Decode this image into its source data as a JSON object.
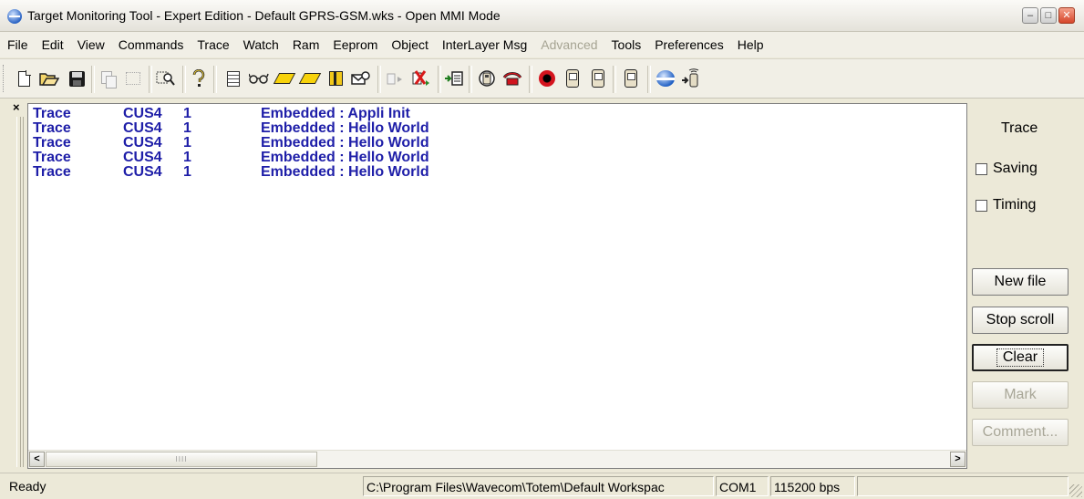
{
  "window": {
    "title": "Target Monitoring Tool - Expert Edition - Default GPRS-GSM.wks - Open MMI Mode",
    "buttons": {
      "minimize": "–",
      "maximize": "□",
      "close": "✕"
    }
  },
  "menu": {
    "items": [
      {
        "label": "File",
        "enabled": true
      },
      {
        "label": "Edit",
        "enabled": true
      },
      {
        "label": "View",
        "enabled": true
      },
      {
        "label": "Commands",
        "enabled": true
      },
      {
        "label": "Trace",
        "enabled": true
      },
      {
        "label": "Watch",
        "enabled": true
      },
      {
        "label": "Ram",
        "enabled": true
      },
      {
        "label": "Eeprom",
        "enabled": true
      },
      {
        "label": "Object",
        "enabled": true
      },
      {
        "label": "InterLayer Msg",
        "enabled": true
      },
      {
        "label": "Advanced",
        "enabled": false
      },
      {
        "label": "Tools",
        "enabled": true
      },
      {
        "label": "Preferences",
        "enabled": true
      },
      {
        "label": "Help",
        "enabled": true
      }
    ]
  },
  "toolbar": {
    "icons": [
      "new-file-icon",
      "open-folder-icon",
      "save-icon",
      "copy-icon",
      "select-icon",
      "find-icon",
      "help-icon",
      "notepad-icon",
      "glasses-icon",
      "edit-icon",
      "edit-icon",
      "gift-icon",
      "message-icon",
      "play-icon",
      "stop-icon",
      "insert-icon",
      "phone-icon",
      "plug-icon",
      "record-icon",
      "phone-up-icon",
      "phone-down-icon",
      "phone-edit-icon",
      "connect-icon",
      "signal-icon"
    ]
  },
  "trace": {
    "lines": [
      {
        "type": "Trace",
        "module": "CUS4",
        "level": "1",
        "message": "Embedded : Appli Init"
      },
      {
        "type": "Trace",
        "module": "CUS4",
        "level": "1",
        "message": "Embedded : Hello World"
      },
      {
        "type": "Trace",
        "module": "CUS4",
        "level": "1",
        "message": "Embedded : Hello World"
      },
      {
        "type": "Trace",
        "module": "CUS4",
        "level": "1",
        "message": "Embedded : Hello World"
      },
      {
        "type": "Trace",
        "module": "CUS4",
        "level": "1",
        "message": "Embedded : Hello World"
      }
    ],
    "text_color": "#1e1ea8"
  },
  "side_panel": {
    "title": "Trace",
    "saving_label": "Saving",
    "timing_label": "Timing",
    "saving_checked": false,
    "timing_checked": false,
    "new_file_label": "New file",
    "stop_scroll_label": "Stop scroll",
    "clear_label": "Clear",
    "mark_label": "Mark",
    "comment_label": "Comment..."
  },
  "dock": {
    "close_glyph": "×"
  },
  "scroll": {
    "left_arrow": "<",
    "right_arrow": ">",
    "thumb_grip": "IIII"
  },
  "status": {
    "ready": "Ready",
    "path": "C:\\Program Files\\Wavecom\\Totem\\Default Workspac",
    "port": "COM1",
    "baud": "115200 bps"
  }
}
